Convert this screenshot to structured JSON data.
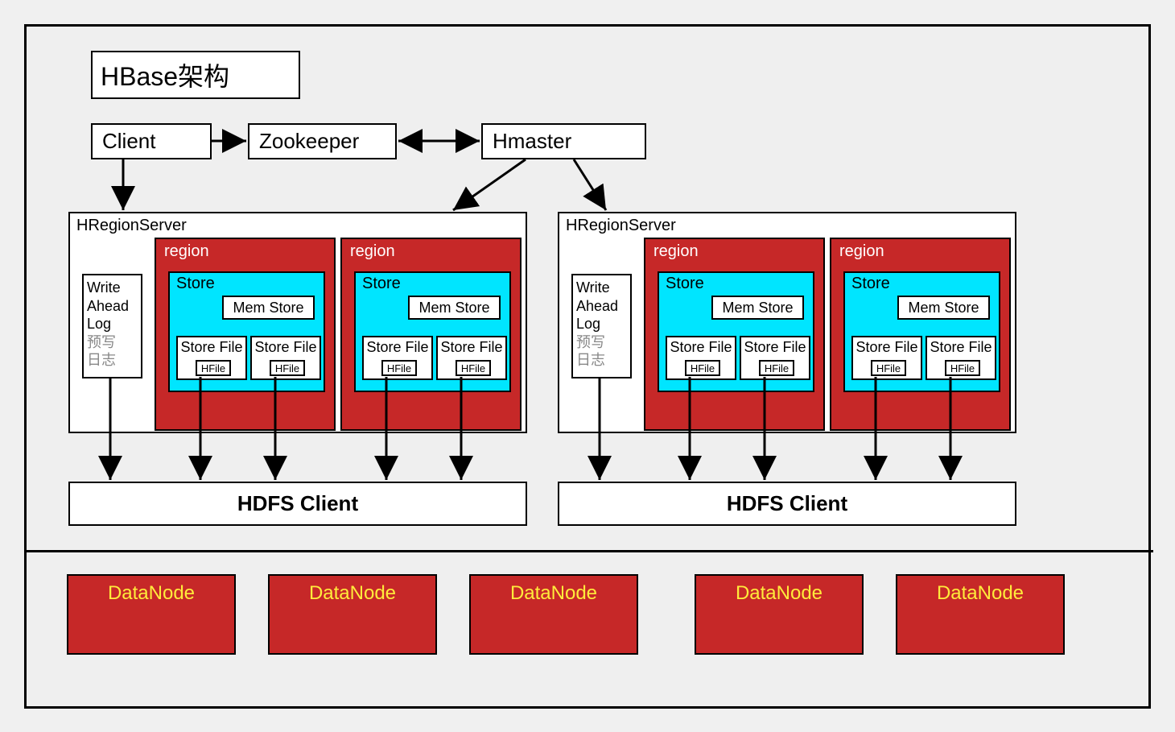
{
  "title": "HBase架构",
  "top": {
    "client": "Client",
    "zookeeper": "Zookeeper",
    "hmaster": "Hmaster"
  },
  "regionserver_label": "HRegionServer",
  "wal": {
    "l1": "Write",
    "l2": "Ahead",
    "l3": "Log",
    "l4": "预写",
    "l5": "日志"
  },
  "region_label": "region",
  "store_label": "Store",
  "memstore_label": "Mem Store",
  "storefile_label": "Store File",
  "hfile_label": "HFile",
  "hdfs_client": "HDFS Client",
  "datanode_label": "DataNode",
  "colors": {
    "region_bg": "#c62828",
    "store_bg": "#00e5ff",
    "datanode_text": "#ffeb3b"
  }
}
